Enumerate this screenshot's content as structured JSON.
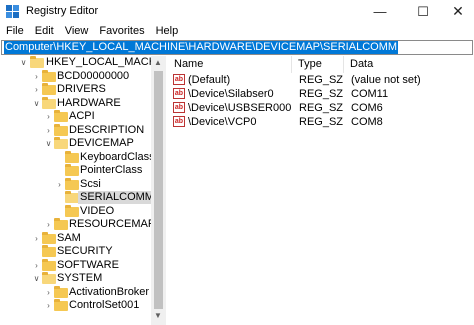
{
  "window": {
    "title": "Registry Editor",
    "minimize": "—",
    "maximize": "☐",
    "close": "✕"
  },
  "menu": [
    "File",
    "Edit",
    "View",
    "Favorites",
    "Help"
  ],
  "address": "Computer\\HKEY_LOCAL_MACHINE\\HARDWARE\\DEVICEMAP\\SERIALCOMM",
  "tree": [
    {
      "label": "HKEY_LOCAL_MACHINE",
      "expander": "∨"
    },
    {
      "label": "BCD00000000",
      "expander": "›"
    },
    {
      "label": "DRIVERS",
      "expander": "›"
    },
    {
      "label": "HARDWARE",
      "expander": "∨"
    },
    {
      "label": "ACPI",
      "expander": "›"
    },
    {
      "label": "DESCRIPTION",
      "expander": "›"
    },
    {
      "label": "DEVICEMAP",
      "expander": "∨"
    },
    {
      "label": "KeyboardClass",
      "expander": ""
    },
    {
      "label": "PointerClass",
      "expander": ""
    },
    {
      "label": "Scsi",
      "expander": "›"
    },
    {
      "label": "SERIALCOMM",
      "expander": ""
    },
    {
      "label": "VIDEO",
      "expander": ""
    },
    {
      "label": "RESOURCEMAP",
      "expander": "›"
    },
    {
      "label": "SAM",
      "expander": "›"
    },
    {
      "label": "SECURITY",
      "expander": ""
    },
    {
      "label": "SOFTWARE",
      "expander": "›"
    },
    {
      "label": "SYSTEM",
      "expander": "∨"
    },
    {
      "label": "ActivationBroker",
      "expander": "›"
    },
    {
      "label": "ControlSet001",
      "expander": "›"
    }
  ],
  "columns": {
    "name": "Name",
    "type": "Type",
    "data": "Data"
  },
  "values": [
    {
      "name": "(Default)",
      "type": "REG_SZ",
      "data": "(value not set)"
    },
    {
      "name": "\\Device\\Silabser0",
      "type": "REG_SZ",
      "data": "COM11"
    },
    {
      "name": "\\Device\\USBSER000",
      "type": "REG_SZ",
      "data": "COM6"
    },
    {
      "name": "\\Device\\VCP0",
      "type": "REG_SZ",
      "data": "COM8"
    }
  ],
  "icon_text": "ab"
}
